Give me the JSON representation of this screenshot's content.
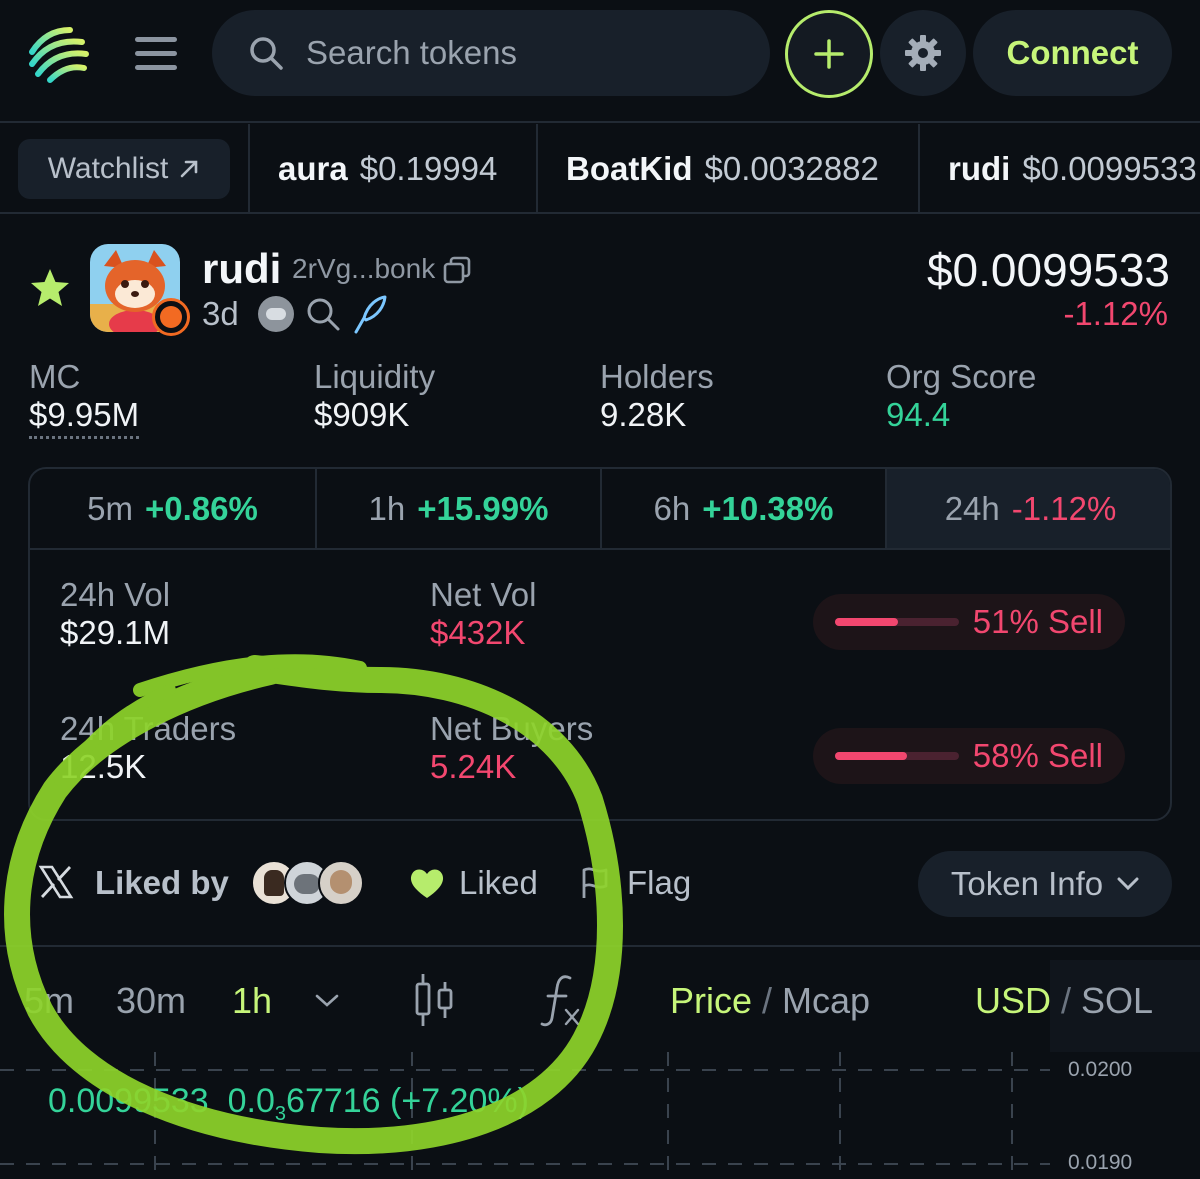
{
  "header": {
    "search_placeholder": "Search tokens",
    "connect_label": "Connect"
  },
  "ticker": {
    "watchlist_label": "Watchlist",
    "items": [
      {
        "symbol": "aura",
        "price": "$0.19994"
      },
      {
        "symbol": "BoatKid",
        "price": "$0.0032882"
      },
      {
        "symbol": "rudi",
        "price": "$0.0099533"
      }
    ]
  },
  "token": {
    "name": "rudi",
    "address": "2rVg...bonk",
    "age": "3d",
    "price": "$0.0099533",
    "change": "-1.12%"
  },
  "stats": [
    {
      "label": "MC",
      "value": "$9.95M"
    },
    {
      "label": "Liquidity",
      "value": "$909K"
    },
    {
      "label": "Holders",
      "value": "9.28K"
    },
    {
      "label": "Org Score",
      "value": "94.4"
    }
  ],
  "timeframes": [
    {
      "label": "5m",
      "change": "+0.86%"
    },
    {
      "label": "1h",
      "change": "+15.99%"
    },
    {
      "label": "6h",
      "change": "+10.38%"
    },
    {
      "label": "24h",
      "change": "-1.12%"
    }
  ],
  "volume": {
    "vol_label": "24h Vol",
    "vol_value": "$29.1M",
    "net_vol_label": "Net Vol",
    "net_vol_value": "$432K",
    "vol_pill": "51% Sell",
    "vol_sell_fraction": 0.51,
    "traders_label": "24h Traders",
    "traders_value": "12.5K",
    "net_buyers_label": "Net Buyers",
    "net_buyers_value": "5.24K",
    "traders_pill": "58% Sell",
    "traders_sell_fraction": 0.58
  },
  "social": {
    "liked_by_label": "Liked by",
    "liked_label": "Liked",
    "flag_label": "Flag",
    "token_info_label": "Token Info"
  },
  "chart_toolbar": {
    "intervals": [
      "5m",
      "30m",
      "1h"
    ],
    "active_interval": "1h",
    "price_label": "Price",
    "mcap_label": "Mcap",
    "usd_label": "USD",
    "sol_label": "SOL"
  },
  "chart": {
    "price_readout": "0.0099533",
    "change_prefix": "0.0",
    "change_sub": "3",
    "change_rest": "67716 (+7.20%)",
    "axis_ticks": [
      "0.0200",
      "0.0190"
    ]
  },
  "colors": {
    "accent": "#c6f57a",
    "positive": "#34d399",
    "negative": "#f2476f",
    "annotation": "#8ed42a"
  }
}
